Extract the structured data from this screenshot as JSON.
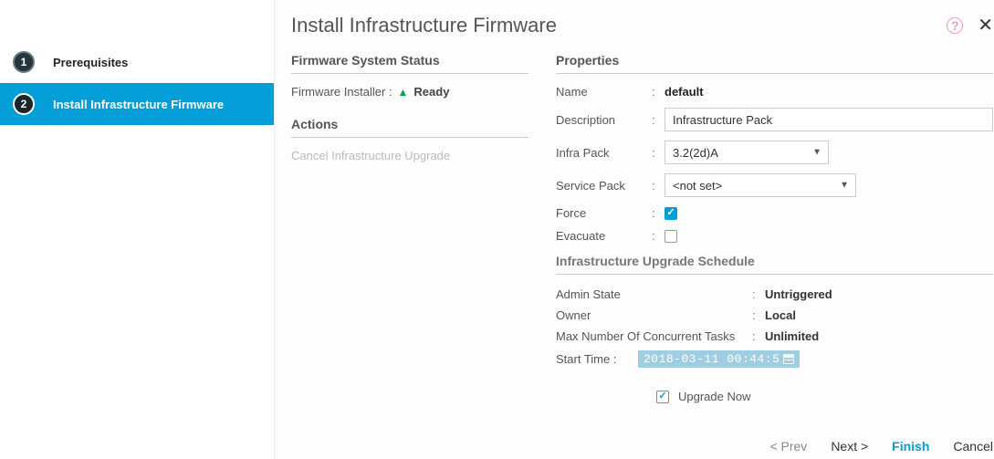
{
  "title": "Install Infrastructure Firmware",
  "sidebar": {
    "steps": [
      {
        "num": "1",
        "label": "Prerequisites"
      },
      {
        "num": "2",
        "label": "Install Infrastructure Firmware"
      }
    ]
  },
  "status": {
    "section_title": "Firmware System Status",
    "installer_label": "Firmware Installer :",
    "installer_value": "Ready"
  },
  "actions": {
    "section_title": "Actions",
    "cancel_label": "Cancel Infrastructure Upgrade"
  },
  "properties": {
    "section_title": "Properties",
    "name_label": "Name",
    "name_value": "default",
    "description_label": "Description",
    "description_value": "Infrastructure Pack",
    "infra_pack_label": "Infra Pack",
    "infra_pack_value": "3.2(2d)A",
    "service_pack_label": "Service Pack",
    "service_pack_value": "<not set>",
    "force_label": "Force",
    "force_checked": true,
    "evacuate_label": "Evacuate",
    "evacuate_checked": false
  },
  "schedule": {
    "section_title": "Infrastructure Upgrade Schedule",
    "admin_state_label": "Admin State",
    "admin_state_value": "Untriggered",
    "owner_label": "Owner",
    "owner_value": "Local",
    "max_tasks_label": "Max Number Of Concurrent Tasks",
    "max_tasks_value": "Unlimited",
    "start_time_label": "Start Time :",
    "start_time_value": "2018-03-11 00:44:5",
    "upgrade_now_label": "Upgrade Now",
    "upgrade_now_checked": true
  },
  "footer": {
    "prev": "< Prev",
    "next": "Next >",
    "finish": "Finish",
    "cancel": "Cancel"
  }
}
